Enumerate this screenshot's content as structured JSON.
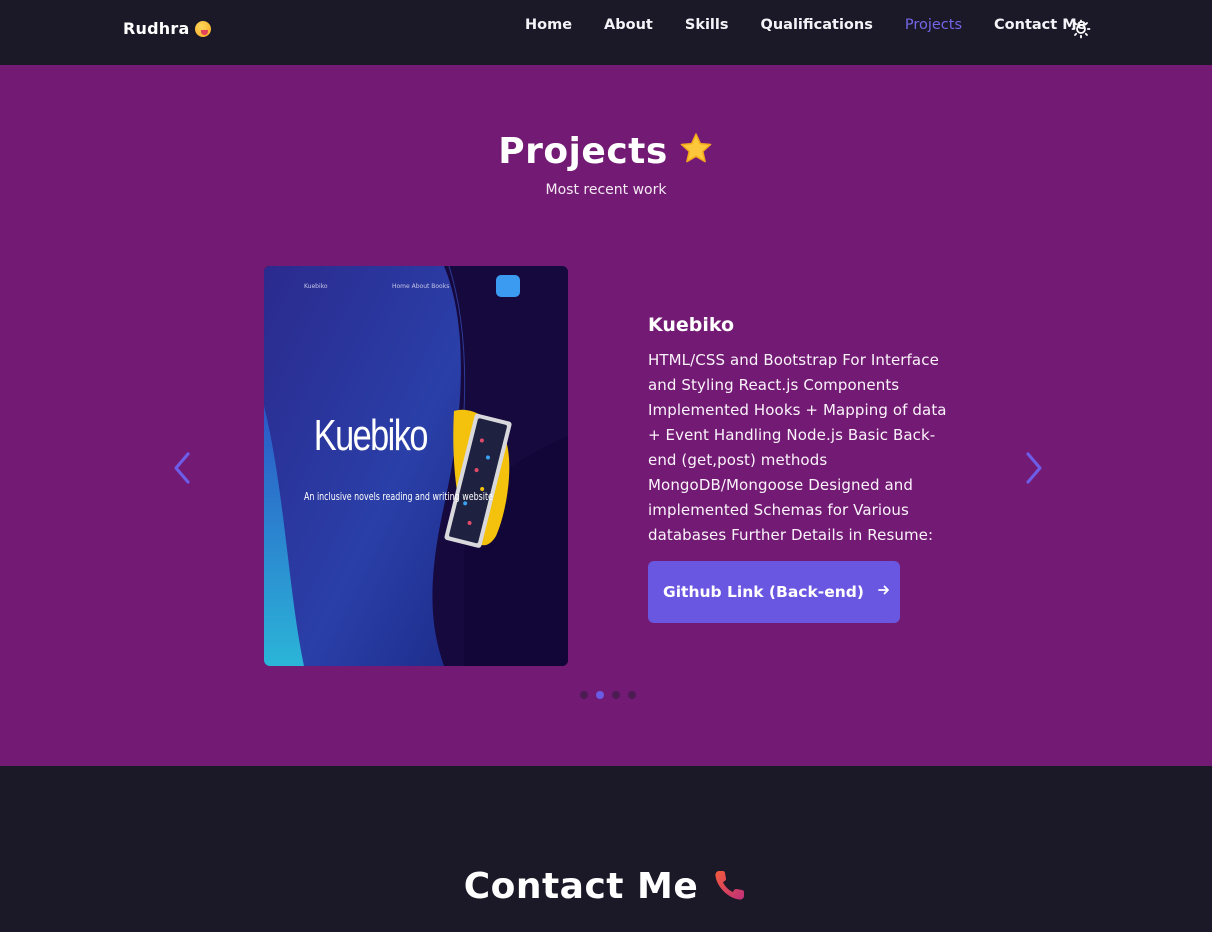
{
  "header": {
    "logo": "Rudhra",
    "logo_icon": "grinning-emoji-icon",
    "nav": [
      {
        "label": "Home",
        "active": false
      },
      {
        "label": "About",
        "active": false
      },
      {
        "label": "Skills",
        "active": false
      },
      {
        "label": "Qualifications",
        "active": false
      },
      {
        "label": "Projects",
        "active": true
      },
      {
        "label": "Contact Me",
        "active": false
      }
    ],
    "theme_toggle_icon": "sun-icon"
  },
  "projects": {
    "title": "Projects",
    "title_icon": "star-icon",
    "subtitle": "Most recent work",
    "slide": {
      "name": "Kuebiko",
      "description": "HTML/CSS and Bootstrap For Interface and Styling React.js Components Implemented Hooks + Mapping of data + Event Handling Node.js Basic Back-end (get,post) methods MongoDB/Mongoose Designed and implemented Schemas for Various databases Further Details in Resume:",
      "button_label": "Github Link (Back-end)",
      "button_icon": "arrow-right-icon",
      "image": {
        "brand": "Kuebiko",
        "links": "Home   About   Books",
        "heading": "Kuebiko",
        "tagline": "An inclusive novels reading and writing website"
      }
    },
    "pagination": {
      "total": 4,
      "active_index": 1
    }
  },
  "contact": {
    "title": "Contact Me",
    "title_icon": "phone-icon"
  },
  "colors": {
    "header_bg": "#1b1827",
    "projects_bg": "#731b74",
    "accent": "#6a57e1",
    "active_nav": "#7367e8"
  }
}
